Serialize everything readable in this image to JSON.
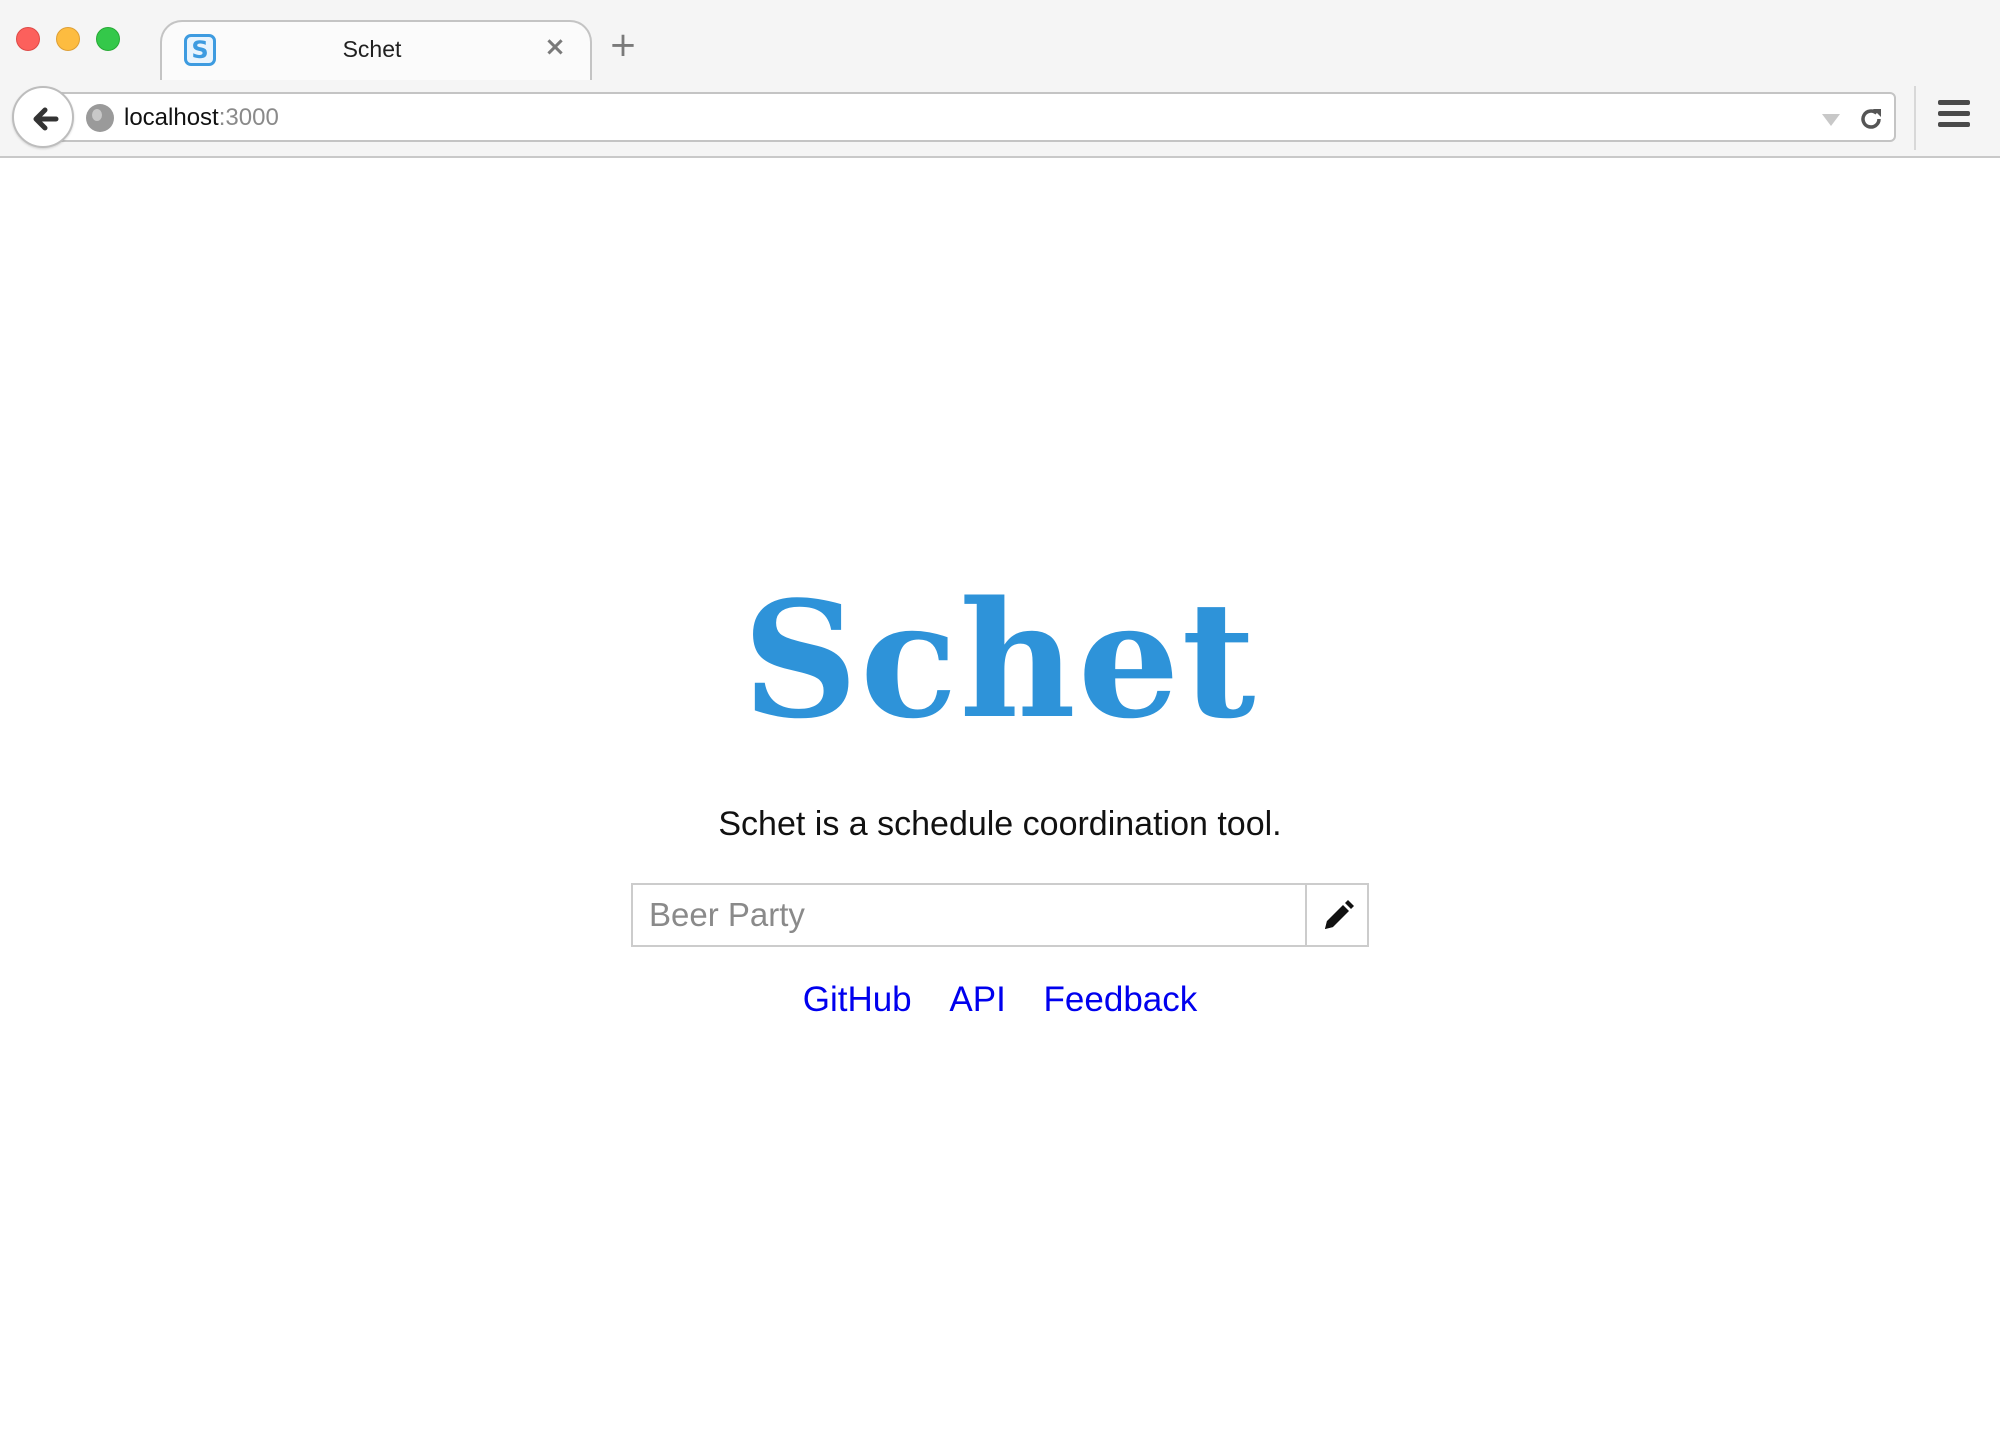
{
  "browser": {
    "tab": {
      "title": "Schet",
      "favicon_letter": "S",
      "close_glyph": "×"
    },
    "new_tab_glyph": "+",
    "address_bar": {
      "host": "localhost",
      "port": ":3000"
    }
  },
  "page": {
    "logo": "Schet",
    "tagline": "Schet is a schedule coordination tool.",
    "event_input": {
      "placeholder": "Beer Party",
      "value": ""
    },
    "create_button_icon": "pencil-icon",
    "links": [
      {
        "label": "GitHub"
      },
      {
        "label": "API"
      },
      {
        "label": "Feedback"
      }
    ]
  },
  "colors": {
    "brand": "#2e93d9",
    "link": "#0000ee"
  }
}
